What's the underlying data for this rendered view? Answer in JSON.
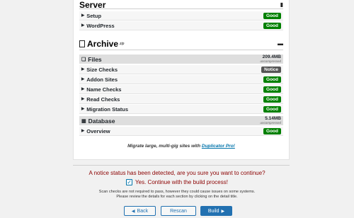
{
  "server": {
    "title": "Server",
    "icon": "database-icon",
    "rows": [
      {
        "label": "Setup",
        "status": "Good"
      },
      {
        "label": "WordPress",
        "status": "Good"
      }
    ]
  },
  "archive": {
    "title": "Archive",
    "type": "zip",
    "icon": "archive-box-icon",
    "files": {
      "label": "Files",
      "size": "209.4MB",
      "size_note": "uncompressed",
      "rows": [
        {
          "label": "Size Checks",
          "status": "Notice"
        },
        {
          "label": "Addon Sites",
          "status": "Good"
        },
        {
          "label": "Name Checks",
          "status": "Good"
        },
        {
          "label": "Read Checks",
          "status": "Good"
        },
        {
          "label": "Migration Status",
          "status": "Good"
        }
      ]
    },
    "database": {
      "label": "Database",
      "size": "5.14MB",
      "size_note": "uncompressed",
      "rows": [
        {
          "label": "Overview",
          "status": "Good"
        }
      ]
    }
  },
  "promo": {
    "text": "Migrate large, multi-gig sites with",
    "link": "Duplicator Pro!"
  },
  "notice": {
    "message": "A notice status has been detected, are you sure you want to continue?",
    "confirm_label": "Yes. Continue with the build process!",
    "help_line1": "Scan checks are not required to pass, however they could cause issues on some systems.",
    "help_line2": "Please review the details for each section by clicking on the detail title."
  },
  "buttons": {
    "back": "Back",
    "rescan": "Rescan",
    "build": "Build"
  },
  "colors": {
    "good": "#008000",
    "notice": "#555555",
    "warning_text": "#8b0000",
    "primary": "#2271b1"
  }
}
